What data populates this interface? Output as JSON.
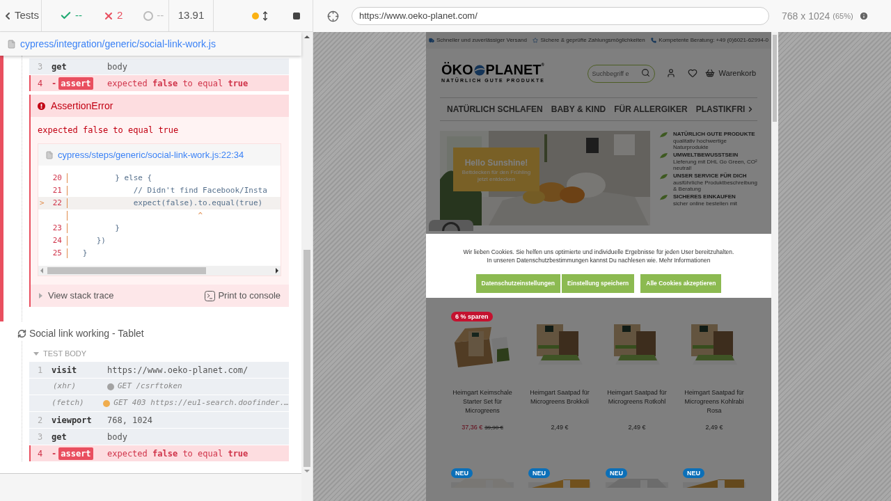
{
  "header": {
    "back": "Tests",
    "passed": "--",
    "failed": "2",
    "pending": "--",
    "duration": "13.91"
  },
  "spec_path": "cypress/integration/generic/social-link-work.js",
  "failed_test": {
    "commands": [
      {
        "kind": "command",
        "num": "3",
        "name": "get",
        "message": "body",
        "failed": false
      },
      {
        "kind": "command",
        "num": "4",
        "prefix": "-",
        "name": "assert",
        "message": "expected **false** to equal **true**",
        "failed": true
      }
    ],
    "error": {
      "title": "AssertionError",
      "message": "expected false to equal true",
      "file": "cypress/steps/generic/social-link-work.js:22:34",
      "code": [
        {
          "num": "20",
          "code": "          } else {"
        },
        {
          "num": "21",
          "code": "              // Didn't find Facebook/Insta"
        },
        {
          "num": "22",
          "marker": ">",
          "current": true,
          "code": "              expect(false).to.equal(true)"
        },
        {
          "code": "                            ^"
        },
        {
          "num": "23",
          "code": "          }"
        },
        {
          "num": "24",
          "code": "      })"
        },
        {
          "num": "25",
          "code": "   }"
        }
      ],
      "stack": "View stack trace",
      "print": "Print to console"
    }
  },
  "test": {
    "title": "Social link working - Tablet",
    "section": "TEST BODY",
    "commands": [
      {
        "kind": "command",
        "num": "1",
        "name": "visit",
        "message": "https://www.oeko-planet.com/",
        "failed": false
      },
      {
        "kind": "request",
        "name": "(xhr)",
        "color": "#a3a3a3",
        "message": "GET /csrftoken",
        "failed": false
      },
      {
        "kind": "request",
        "name": "(fetch)",
        "color": "#f0ad4e",
        "message": "GET 403 https://eu1-search.doofinder.…",
        "failed": false
      },
      {
        "kind": "command",
        "num": "2",
        "name": "viewport",
        "message": "768, 1024",
        "failed": false
      },
      {
        "kind": "command",
        "num": "3",
        "name": "get",
        "message": "body",
        "failed": false
      },
      {
        "kind": "command",
        "num": "4",
        "prefix": "-",
        "name": "assert",
        "message": "expected **false** to equal **true**",
        "failed": true
      }
    ]
  },
  "browser": {
    "url": "https://www.oeko-planet.com/",
    "viewport": "768 x 1024",
    "zoom": "(65%)"
  },
  "site": {
    "usps": [
      {
        "kind": "shipping",
        "text": "Schneller und zuverlässiger Versand"
      },
      {
        "kind": "payment",
        "text": "Sichere & geprüfte Zahlungsmöglichkeiten"
      },
      {
        "kind": "phone",
        "text": "Kompetente Beratung: +49 (0)6021-62994-0"
      }
    ],
    "logo": {
      "left": "ÖKO",
      "right": "PLANET",
      "reg": "®",
      "tagline": "NATÜRLICH GUTE PRODUKTE"
    },
    "search_placeholder": "Suchbegriff e",
    "cart": "Warenkorb",
    "nav": [
      "NATÜRLICH SCHLAFEN",
      "BABY & KIND",
      "FÜR ALLERGIKER",
      "PLASTIKFRI"
    ],
    "hero": {
      "title": "Hello Sunshine!",
      "lines": [
        "Bettdecken für den Frühling",
        "jetzt entdecken"
      ]
    },
    "features": [
      {
        "title": "NATÜRLICH GUTE PRODUKTE",
        "text": "qualitativ hochwertige Naturprodukte"
      },
      {
        "title": "UMWELTBEWUSSTSEIN",
        "text": "Lieferung mit DHL Go Green, CO² neutral!"
      },
      {
        "title": "UNSER SERVICE FÜR DICH",
        "text": "ausführliche Produktbeschreibung & Beratung"
      },
      {
        "title": "SICHERES EINKAUFEN",
        "text": "sicher online bestellen mit"
      }
    ],
    "cookie": {
      "lines": [
        "Wir lieben Cookies. Sie helfen uns optimierte und individuelle Ergebnisse für jeden User bereitzuhalten.",
        "In unseren Datenschutzbestimmungen kannst Du nachlesen wie. Mehr Informationen"
      ],
      "buttons": [
        "Datenschutzeinstellungen",
        "Einstellung speichern",
        "Alle Cookies akzeptieren"
      ]
    },
    "products": [
      {
        "kind": "set",
        "badge": {
          "kind": "sale",
          "text": "6 % sparen"
        },
        "name": "Heimgart Keimschale Starter Set für Microgreens",
        "price": "37,36 €",
        "old_price": "39,90 €"
      },
      {
        "kind": "pad",
        "name": "Heimgart Saatpad für Microgreens Brokkoli",
        "price": "2,49 €"
      },
      {
        "kind": "pad",
        "name": "Heimgart Saatpad für Microgreens Rotkohl",
        "price": "2,49 €"
      },
      {
        "kind": "pad",
        "name": "Heimgart Saatpad für Microgreens Kohlrabi Rosa",
        "price": "2,49 €"
      }
    ],
    "more_products": [
      {
        "badge": {
          "kind": "new",
          "text": "NEU"
        }
      },
      {
        "badge": {
          "kind": "new",
          "text": "NEU"
        }
      },
      {
        "badge": {
          "kind": "new",
          "text": "NEU"
        }
      },
      {
        "badge": {
          "kind": "new",
          "text": "NEU"
        }
      }
    ]
  }
}
